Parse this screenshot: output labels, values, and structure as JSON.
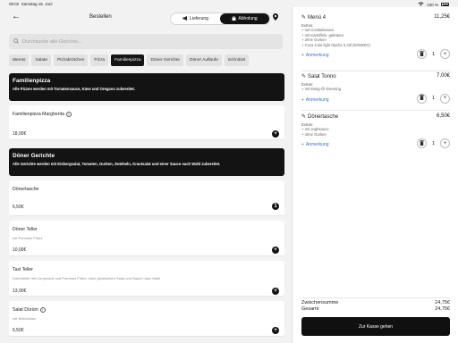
{
  "status": {
    "time": "09:02",
    "date": "Samstag 15. Juni",
    "battery": "100 %"
  },
  "header": {
    "title": "Bestellen",
    "delivery_label": "Lieferung",
    "pickup_label": "Abholung"
  },
  "search": {
    "placeholder": "Durchsuche alle Gerichte..."
  },
  "categories": [
    "Menüs",
    "Salate",
    "Pizzabrötchen",
    "Pizza",
    "Familienpizza",
    "Döner Gerichte",
    "Döner Aufläufe",
    "Schnitzel"
  ],
  "sections": {
    "family": {
      "title": "Familienpizza",
      "subtitle": "Alle Pizzen werden mit Tomatensauce, Käse und Oregano zubereitet."
    },
    "doner": {
      "title": "Döner Gerichte",
      "subtitle": "Alle Gerichte werden mit Eisbergsalat, Tomaten, Gurken, Zwiebeln, Krautsalat und einer Sauce nach Wahl zubereitet."
    }
  },
  "items": [
    {
      "name": "Familienpizza Margherita",
      "desc": "",
      "price": "18,00€"
    },
    {
      "name": "Dönertasche",
      "desc": "",
      "price": "6,50€",
      "qty": "1"
    },
    {
      "name": "Döner Teller",
      "desc": "mit Pommes Frites",
      "price": "10,00€"
    },
    {
      "name": "Taxi Teller",
      "desc": "Dönerteller mit Currywurst und Pommes Frites, ohne gemischten Salat und Sauce nach Wahl",
      "price": "13,00€"
    },
    {
      "name": "Salat Dürüm",
      "desc": "mit Weichkäse",
      "price": "6,50€"
    }
  ],
  "cart": {
    "items": [
      {
        "name": "Menü 4",
        "price": "11,25€",
        "extras_label": "Extras:",
        "extras": [
          "+ mit Cocktailsauce",
          "+ mit Kartoffeln, gebraten",
          "+ ohne Gurken",
          "+ Coca-Cola light fasche 0,33l (EINWEG)"
        ],
        "anmerkung": "Anmerkung",
        "qty": "1"
      },
      {
        "name": "Salat Tonno",
        "price": "7,00€",
        "extras_label": "Extras:",
        "extras": [
          "+ mit Essig-Öl-Dressing"
        ],
        "anmerkung": "Anmerkung",
        "qty": "1"
      },
      {
        "name": "Dönertasche",
        "price": "6,50€",
        "extras_label": "Extras:",
        "extras": [
          "+ mit Joghsauce",
          "+ ohne Gurken"
        ],
        "anmerkung": "Anmerkung",
        "qty": "1"
      }
    ],
    "subtotal_label": "Zwischensumme",
    "subtotal": "24,75€",
    "total_label": "Gesamt",
    "total": "24,75€",
    "checkout_label": "Zur Kasse gehen"
  },
  "icons": {
    "plus": "+",
    "back": "←"
  }
}
